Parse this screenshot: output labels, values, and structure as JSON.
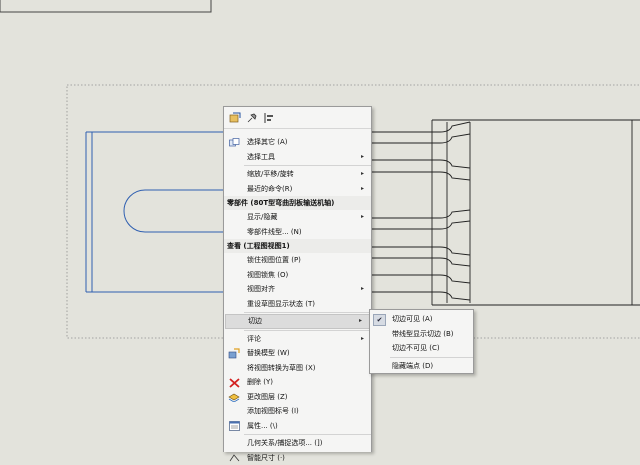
{
  "toolbar": {
    "icons": [
      "smart-dimension-icon",
      "pin-icon",
      "align-icon"
    ]
  },
  "menu": {
    "group1": [
      {
        "label": "选择其它 (A)",
        "icon": "select-other-icon",
        "submenu": false
      },
      {
        "label": "选择工具",
        "submenu": true
      },
      {
        "label": "缩放/平移/旋转",
        "submenu": true
      },
      {
        "label": "最近的命令(R)",
        "submenu": true
      }
    ],
    "header_part": "零部件 (80T型弯曲刮板输送机轴)",
    "group2": [
      {
        "label": "显示/隐藏",
        "submenu": true
      },
      {
        "label": "零部件线型... (N)",
        "submenu": false
      }
    ],
    "header_view": "查看 (工程图视图1)",
    "group3": [
      {
        "label": "锁住视图位置 (P)",
        "submenu": false
      },
      {
        "label": "视图锁焦 (O)",
        "submenu": false
      },
      {
        "label": "视图对齐",
        "submenu": true
      },
      {
        "label": "重设草图显示状态 (T)",
        "submenu": false
      }
    ],
    "tangent": {
      "label": "切边",
      "submenu": true
    },
    "comment": {
      "label": "评论",
      "submenu": true
    },
    "group4": [
      {
        "label": "替换模型 (W)",
        "icon": "replace-model-icon"
      },
      {
        "label": "将视图转换为草图 (X)",
        "icon": ""
      },
      {
        "label": "删除 (Y)",
        "icon": "delete-icon"
      },
      {
        "label": "更改图层 (Z)",
        "icon": "layer-icon"
      },
      {
        "label": "添加视图标号 (I)",
        "icon": ""
      },
      {
        "label": "属性... (\\)",
        "icon": "properties-icon"
      }
    ],
    "relations": "几何关系/捕捉选项... (])",
    "last": "智能尺寸 (·)"
  },
  "submenu": {
    "items": [
      "切边可见 (A)",
      "带线型显示切边 (B)",
      "切边不可见 (C)"
    ],
    "checked_index": 0,
    "last": "隐藏端点 (D)"
  },
  "colors": {
    "selection_blue": "#2f5fb0",
    "delete_red": "#d32020"
  }
}
